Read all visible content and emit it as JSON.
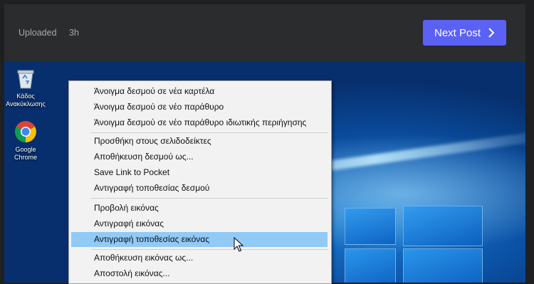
{
  "header": {
    "uploaded_label": "Uploaded",
    "uploaded_ago": "3h",
    "next_post_label": "Next Post",
    "accent_color": "#5b61f5"
  },
  "desktop": {
    "icons": [
      {
        "name": "recycle-bin",
        "label_line1": "Κάδος",
        "label_line2": "Ανακύκλωσης"
      },
      {
        "name": "google-chrome",
        "label_line1": "Google",
        "label_line2": "Chrome"
      }
    ]
  },
  "context_menu": {
    "items": [
      "Άνοιγμα δεσμού σε νέα καρτέλα",
      "Άνοιγμα δεσμού σε νέο παράθυρο",
      "Άνοιγμα δεσμού σε νέο παράθυρο ιδιωτικής περιήγησης",
      "Προσθήκη στους σελιδοδείκτες",
      "Αποθήκευση δεσμού ως...",
      "Save Link to Pocket",
      "Αντιγραφή τοποθεσίας δεσμού",
      "Προβολή εικόνας",
      "Αντιγραφή εικόνας",
      "Αντιγραφή τοποθεσίας εικόνας",
      "Αποθήκευση εικόνας ως...",
      "Αποστολή εικόνας..."
    ],
    "highlighted_item": "Αντιγραφή τοποθεσίας εικόνας",
    "highlight_color": "#91c9f7"
  }
}
